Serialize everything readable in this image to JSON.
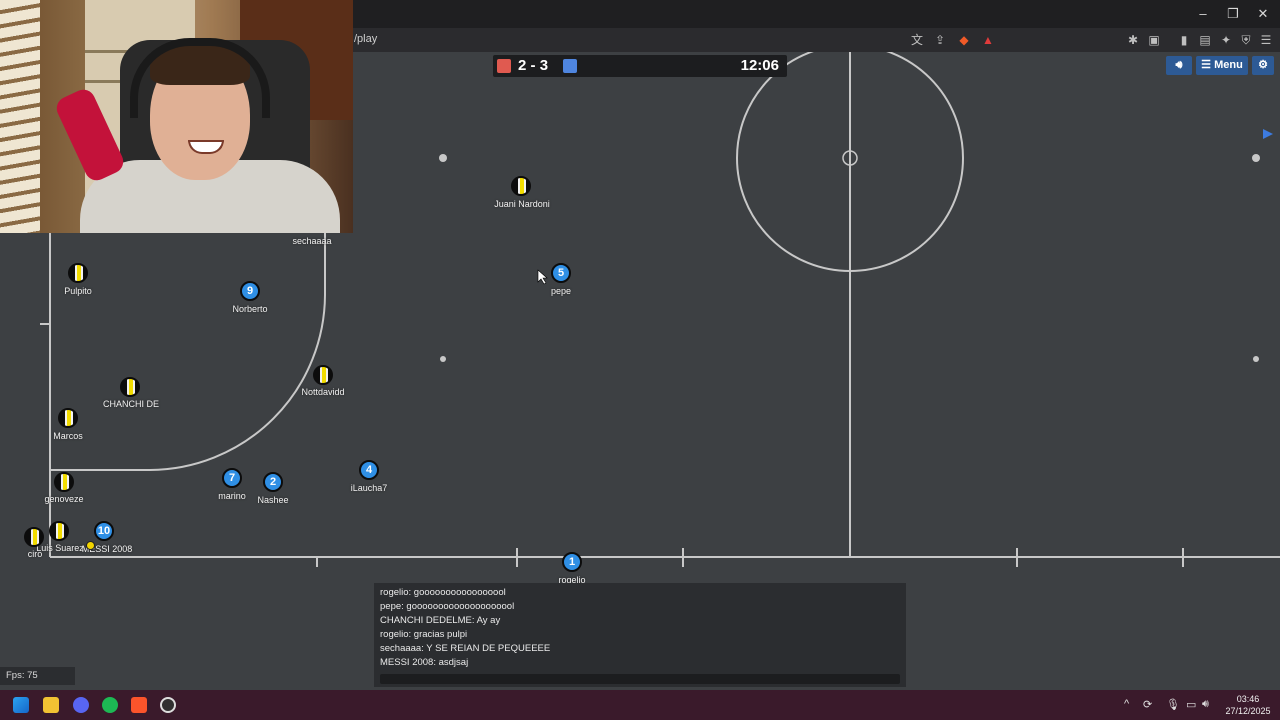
{
  "browser": {
    "url": "/play"
  },
  "scoreboard": {
    "red_score": "2",
    "separator": "-",
    "blue_score": "3",
    "clock": "12:06",
    "red_color": "#e05a50",
    "blue_color": "#4f86e0"
  },
  "game_buttons": {
    "sound_icon": "speaker-icon",
    "menu_label": "Menu",
    "settings_icon": "gear-icon"
  },
  "players_red": [
    {
      "name": "Juani Nardoni",
      "number": ""
    },
    {
      "name": "sechaaaa",
      "number": ""
    },
    {
      "name": "Pulpito",
      "number": ""
    },
    {
      "name": "CHANCHI DE",
      "number": ""
    },
    {
      "name": "Marcos",
      "number": ""
    },
    {
      "name": "Nottdavidd",
      "number": ""
    },
    {
      "name": "genoveze",
      "number": ""
    },
    {
      "name": "Luis Suarez",
      "number": ""
    },
    {
      "name": "ciro",
      "number": ""
    }
  ],
  "players_blue": [
    {
      "name": "pepe",
      "number": "5"
    },
    {
      "name": "Norberto",
      "number": "9"
    },
    {
      "name": "marino",
      "number": "7"
    },
    {
      "name": "Nashee",
      "number": "2"
    },
    {
      "name": "iLaucha7",
      "number": "4"
    },
    {
      "name": "MESSI 2008",
      "number": "10"
    },
    {
      "name": "rogelio",
      "number": "1"
    }
  ],
  "chat": {
    "messages": [
      "rogelio: gooooooooooooooool",
      "pepe: goooooooooooooooooool",
      "CHANCHI DEDELME: Ay ay",
      "rogelio: gracias pulpi",
      "sechaaaa: Y SE REIAN DE PEQUEEEE",
      "MESSI 2008: asdjsaj"
    ]
  },
  "fps": "Fps: 75",
  "taskbar": {
    "time": "03:46",
    "date": "27/12/2025",
    "apps": [
      "windows-start-icon",
      "file-explorer-icon",
      "discord-icon",
      "spotify-icon",
      "brave-icon",
      "obs-icon"
    ]
  }
}
